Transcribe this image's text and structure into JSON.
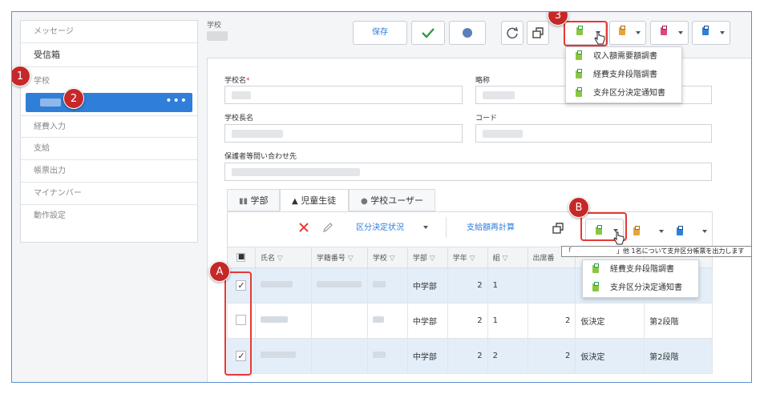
{
  "sidebar": {
    "items": [
      {
        "label": "メッセージ"
      },
      {
        "label": "受信箱"
      },
      {
        "label": "学校"
      },
      {
        "label": "経費入力"
      },
      {
        "label": "支給"
      },
      {
        "label": "帳票出力"
      },
      {
        "label": "マイナンバー"
      },
      {
        "label": "動作設定"
      }
    ],
    "more_glyph": "•••"
  },
  "header": {
    "breadcrumb": "学校",
    "save_label": "保存"
  },
  "form": {
    "school_name_label": "学校名",
    "required_mark": "*",
    "abbrev_label": "略称",
    "principal_label": "学校長名",
    "code_label": "コード",
    "guardian_contact_label": "保護者等問い合わせ先"
  },
  "tabs": [
    {
      "label": "学部"
    },
    {
      "label": "児童生徒"
    },
    {
      "label": "学校ユーザー"
    }
  ],
  "grid_toolbar": {
    "status_label": "区分決定状況",
    "recalc_label": "支給額再計算"
  },
  "table": {
    "headers": [
      "氏名",
      "学籍番号",
      "学校",
      "学部",
      "学年",
      "組",
      "出席番"
    ],
    "rows": [
      {
        "checked": true,
        "dept": "中学部",
        "grade": "2",
        "class": "1",
        "seat": "",
        "status": "",
        "stage": ""
      },
      {
        "checked": false,
        "dept": "中学部",
        "grade": "2",
        "class": "1",
        "seat": "2",
        "status": "仮決定",
        "stage": "第2段階"
      },
      {
        "checked": true,
        "dept": "中学部",
        "grade": "2",
        "class": "2",
        "seat": "2",
        "status": "仮決定",
        "stage": "第2段階"
      }
    ],
    "check_mark": "✓"
  },
  "dropdown_top": {
    "items": [
      "収入額需要額調書",
      "経費支弁段階調書",
      "支弁区分決定通知書"
    ]
  },
  "dropdown_grid": {
    "items": [
      "経費支弁段階調書",
      "支弁区分決定通知書"
    ]
  },
  "tooltip": {
    "text": "「　　　　　　　」他 1名について支弁区分帳票を出力します"
  },
  "callouts": [
    "1",
    "2",
    "3",
    "A",
    "B"
  ],
  "colors": {
    "accent": "#2f7fd8",
    "callout": "#c62828",
    "highlight_box": "#e53935",
    "selected_row": "#e3eef9",
    "doc_green": "#8cc63f",
    "doc_orange": "#e8a33c",
    "doc_pink": "#e0457b",
    "doc_blue": "#2f7fd8"
  }
}
